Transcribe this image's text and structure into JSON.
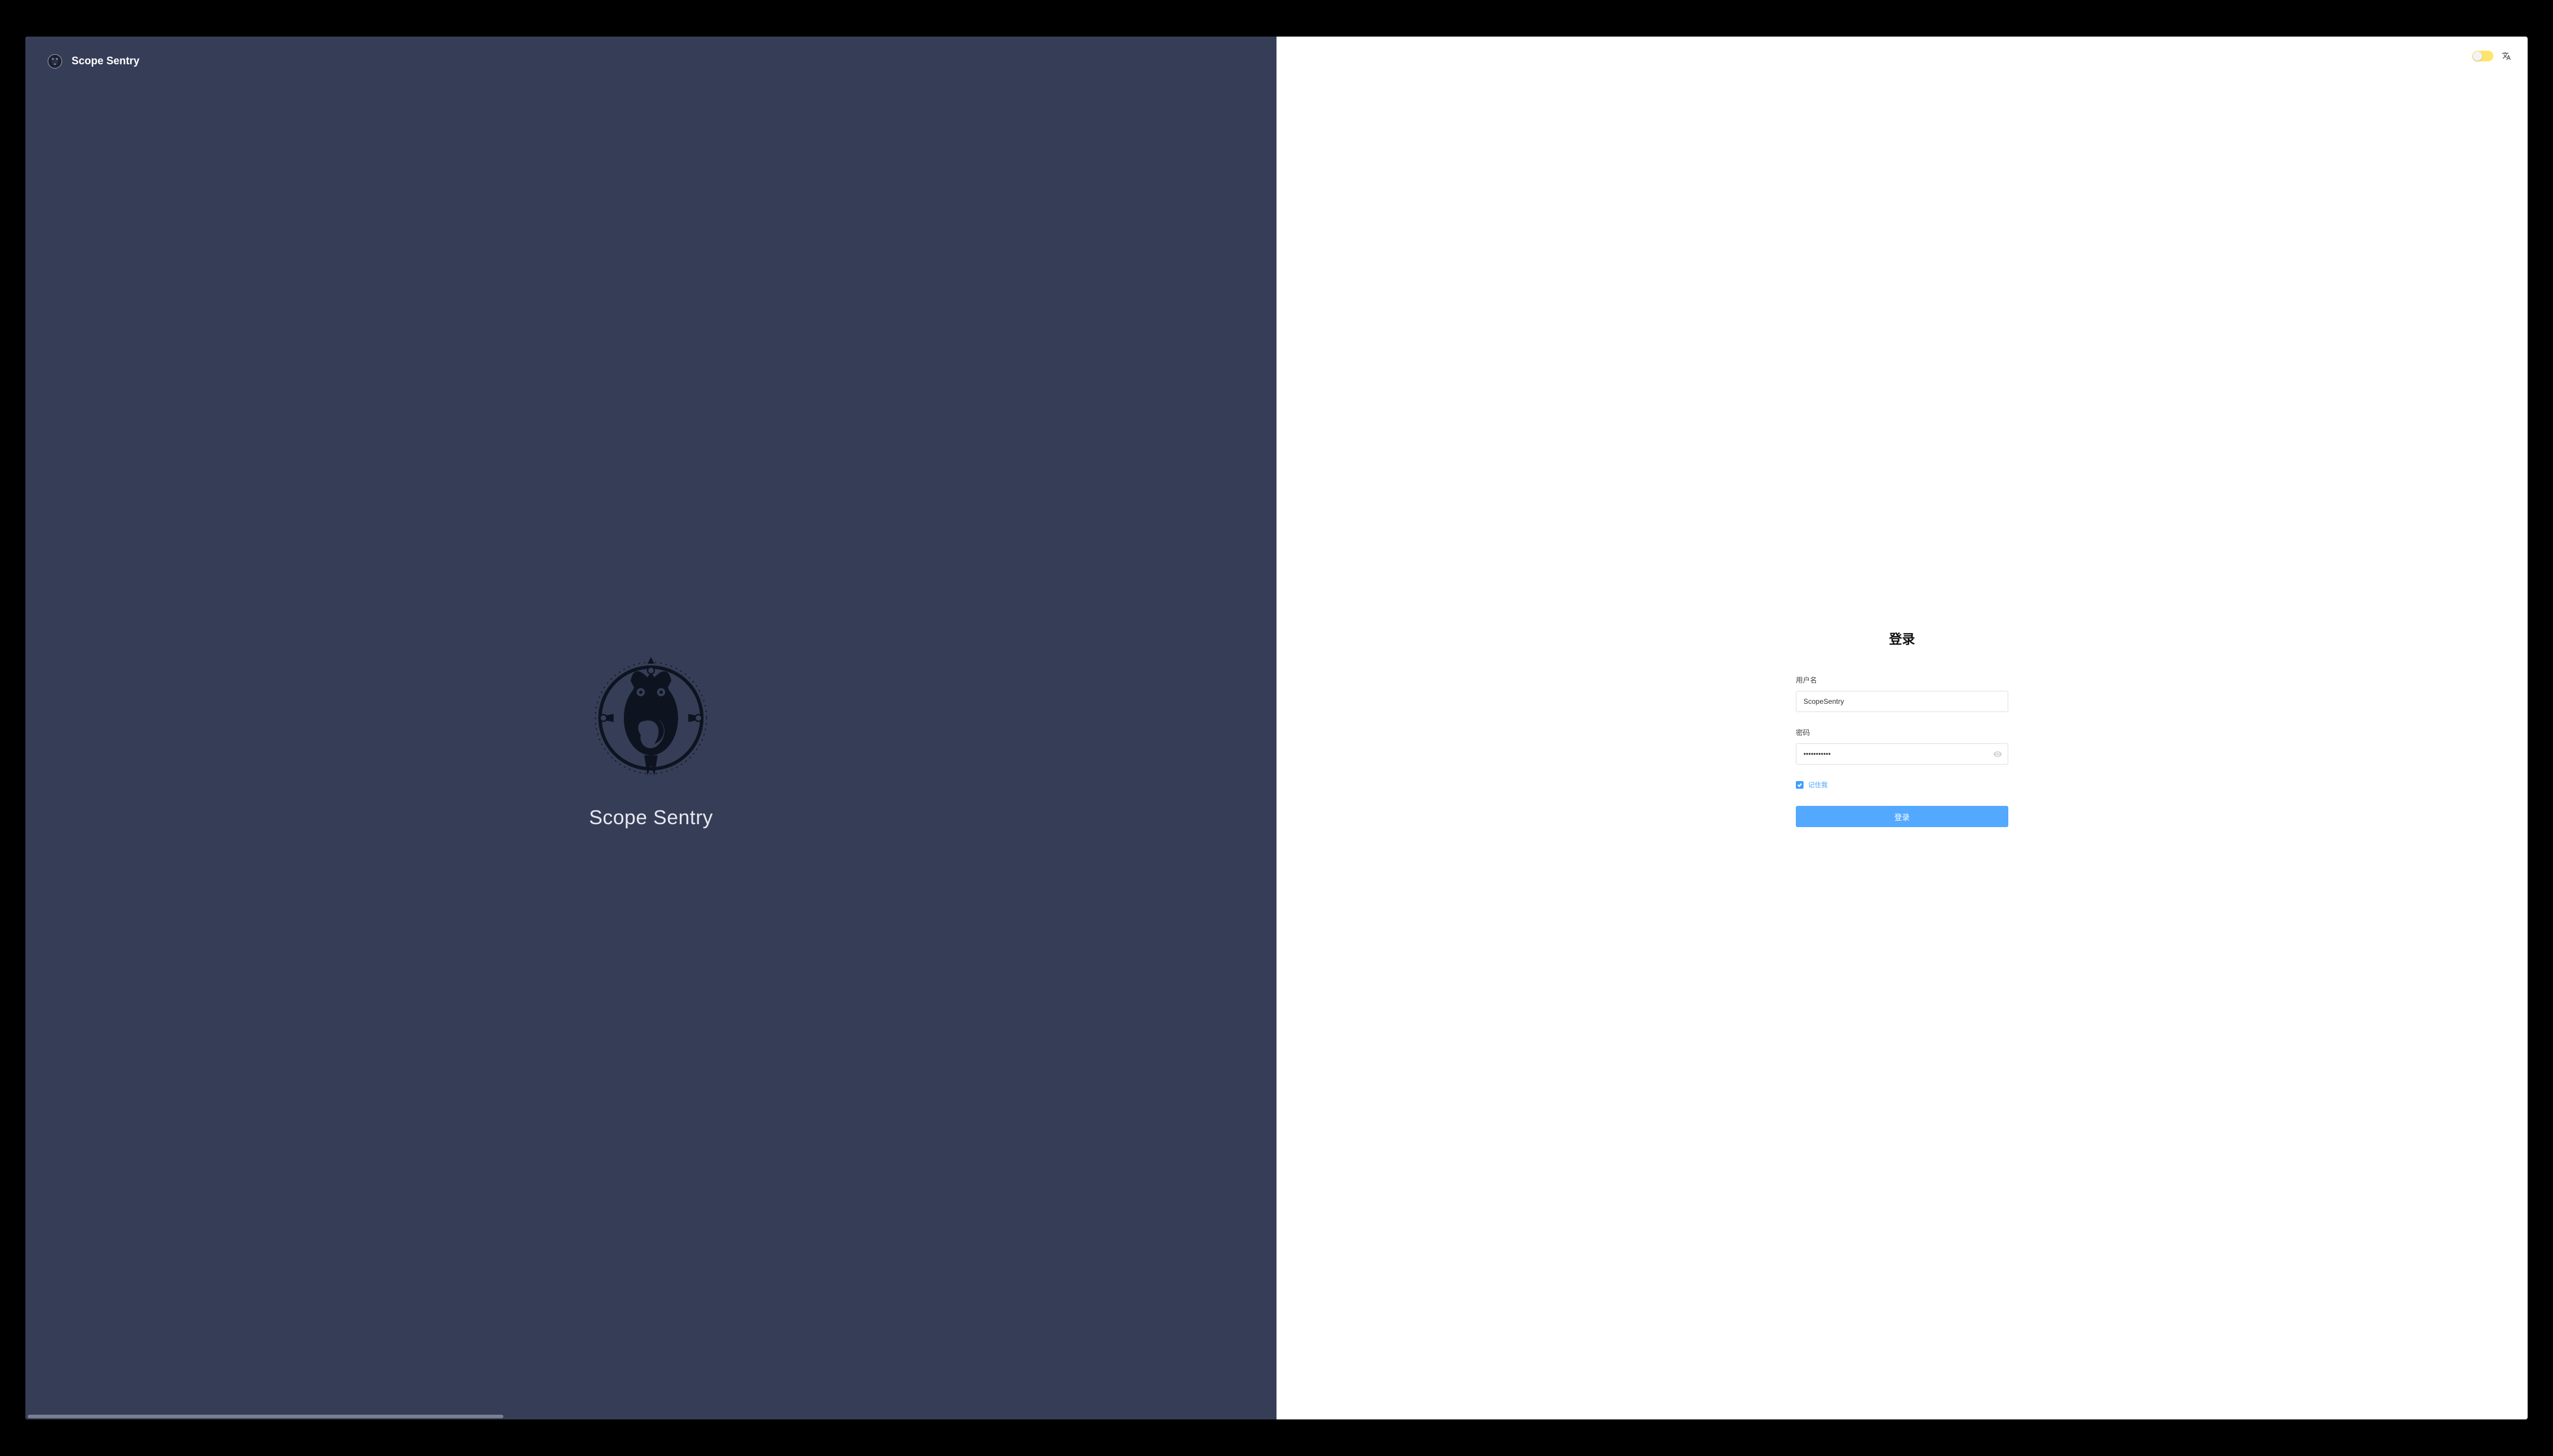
{
  "app": {
    "title": "Scope Sentry",
    "large_title": "Scope Sentry"
  },
  "login": {
    "heading": "登录",
    "username_label": "用户名",
    "username_value": "ScopeSentry",
    "password_label": "密码",
    "password_value": "•••••••••••",
    "remember_label": "记住我",
    "remember_checked": true,
    "submit_label": "登录"
  },
  "controls": {
    "theme_toggle_on": false,
    "language_icon": "language-icon"
  }
}
